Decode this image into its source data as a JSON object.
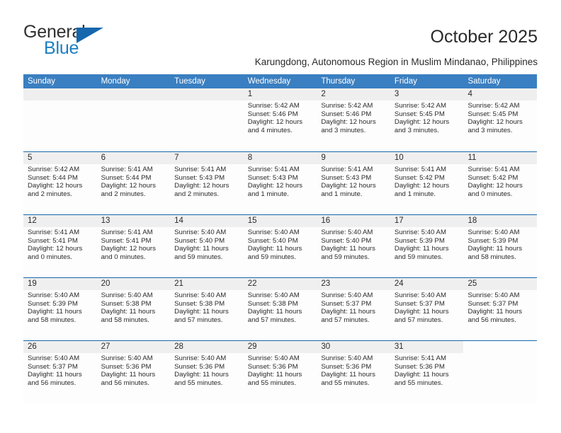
{
  "brand": {
    "name_part1": "General",
    "name_part2": "Blue",
    "accent_color": "#1667ad"
  },
  "header": {
    "month_title": "October 2025",
    "location": "Karungdong, Autonomous Region in Muslim Mindanao, Philippines"
  },
  "calendar": {
    "header_bg": "#3a7fc1",
    "weekdays": [
      "Sunday",
      "Monday",
      "Tuesday",
      "Wednesday",
      "Thursday",
      "Friday",
      "Saturday"
    ],
    "weeks": [
      [
        {
          "day": "",
          "sunrise": "",
          "sunset": "",
          "daylight": "",
          "daylight2": ""
        },
        {
          "day": "",
          "sunrise": "",
          "sunset": "",
          "daylight": "",
          "daylight2": ""
        },
        {
          "day": "",
          "sunrise": "",
          "sunset": "",
          "daylight": "",
          "daylight2": ""
        },
        {
          "day": "1",
          "sunrise": "Sunrise: 5:42 AM",
          "sunset": "Sunset: 5:46 PM",
          "daylight": "Daylight: 12 hours",
          "daylight2": "and 4 minutes."
        },
        {
          "day": "2",
          "sunrise": "Sunrise: 5:42 AM",
          "sunset": "Sunset: 5:46 PM",
          "daylight": "Daylight: 12 hours",
          "daylight2": "and 3 minutes."
        },
        {
          "day": "3",
          "sunrise": "Sunrise: 5:42 AM",
          "sunset": "Sunset: 5:45 PM",
          "daylight": "Daylight: 12 hours",
          "daylight2": "and 3 minutes."
        },
        {
          "day": "4",
          "sunrise": "Sunrise: 5:42 AM",
          "sunset": "Sunset: 5:45 PM",
          "daylight": "Daylight: 12 hours",
          "daylight2": "and 3 minutes."
        }
      ],
      [
        {
          "day": "5",
          "sunrise": "Sunrise: 5:42 AM",
          "sunset": "Sunset: 5:44 PM",
          "daylight": "Daylight: 12 hours",
          "daylight2": "and 2 minutes."
        },
        {
          "day": "6",
          "sunrise": "Sunrise: 5:41 AM",
          "sunset": "Sunset: 5:44 PM",
          "daylight": "Daylight: 12 hours",
          "daylight2": "and 2 minutes."
        },
        {
          "day": "7",
          "sunrise": "Sunrise: 5:41 AM",
          "sunset": "Sunset: 5:43 PM",
          "daylight": "Daylight: 12 hours",
          "daylight2": "and 2 minutes."
        },
        {
          "day": "8",
          "sunrise": "Sunrise: 5:41 AM",
          "sunset": "Sunset: 5:43 PM",
          "daylight": "Daylight: 12 hours",
          "daylight2": "and 1 minute."
        },
        {
          "day": "9",
          "sunrise": "Sunrise: 5:41 AM",
          "sunset": "Sunset: 5:43 PM",
          "daylight": "Daylight: 12 hours",
          "daylight2": "and 1 minute."
        },
        {
          "day": "10",
          "sunrise": "Sunrise: 5:41 AM",
          "sunset": "Sunset: 5:42 PM",
          "daylight": "Daylight: 12 hours",
          "daylight2": "and 1 minute."
        },
        {
          "day": "11",
          "sunrise": "Sunrise: 5:41 AM",
          "sunset": "Sunset: 5:42 PM",
          "daylight": "Daylight: 12 hours",
          "daylight2": "and 0 minutes."
        }
      ],
      [
        {
          "day": "12",
          "sunrise": "Sunrise: 5:41 AM",
          "sunset": "Sunset: 5:41 PM",
          "daylight": "Daylight: 12 hours",
          "daylight2": "and 0 minutes."
        },
        {
          "day": "13",
          "sunrise": "Sunrise: 5:41 AM",
          "sunset": "Sunset: 5:41 PM",
          "daylight": "Daylight: 12 hours",
          "daylight2": "and 0 minutes."
        },
        {
          "day": "14",
          "sunrise": "Sunrise: 5:40 AM",
          "sunset": "Sunset: 5:40 PM",
          "daylight": "Daylight: 11 hours",
          "daylight2": "and 59 minutes."
        },
        {
          "day": "15",
          "sunrise": "Sunrise: 5:40 AM",
          "sunset": "Sunset: 5:40 PM",
          "daylight": "Daylight: 11 hours",
          "daylight2": "and 59 minutes."
        },
        {
          "day": "16",
          "sunrise": "Sunrise: 5:40 AM",
          "sunset": "Sunset: 5:40 PM",
          "daylight": "Daylight: 11 hours",
          "daylight2": "and 59 minutes."
        },
        {
          "day": "17",
          "sunrise": "Sunrise: 5:40 AM",
          "sunset": "Sunset: 5:39 PM",
          "daylight": "Daylight: 11 hours",
          "daylight2": "and 59 minutes."
        },
        {
          "day": "18",
          "sunrise": "Sunrise: 5:40 AM",
          "sunset": "Sunset: 5:39 PM",
          "daylight": "Daylight: 11 hours",
          "daylight2": "and 58 minutes."
        }
      ],
      [
        {
          "day": "19",
          "sunrise": "Sunrise: 5:40 AM",
          "sunset": "Sunset: 5:39 PM",
          "daylight": "Daylight: 11 hours",
          "daylight2": "and 58 minutes."
        },
        {
          "day": "20",
          "sunrise": "Sunrise: 5:40 AM",
          "sunset": "Sunset: 5:38 PM",
          "daylight": "Daylight: 11 hours",
          "daylight2": "and 58 minutes."
        },
        {
          "day": "21",
          "sunrise": "Sunrise: 5:40 AM",
          "sunset": "Sunset: 5:38 PM",
          "daylight": "Daylight: 11 hours",
          "daylight2": "and 57 minutes."
        },
        {
          "day": "22",
          "sunrise": "Sunrise: 5:40 AM",
          "sunset": "Sunset: 5:38 PM",
          "daylight": "Daylight: 11 hours",
          "daylight2": "and 57 minutes."
        },
        {
          "day": "23",
          "sunrise": "Sunrise: 5:40 AM",
          "sunset": "Sunset: 5:37 PM",
          "daylight": "Daylight: 11 hours",
          "daylight2": "and 57 minutes."
        },
        {
          "day": "24",
          "sunrise": "Sunrise: 5:40 AM",
          "sunset": "Sunset: 5:37 PM",
          "daylight": "Daylight: 11 hours",
          "daylight2": "and 57 minutes."
        },
        {
          "day": "25",
          "sunrise": "Sunrise: 5:40 AM",
          "sunset": "Sunset: 5:37 PM",
          "daylight": "Daylight: 11 hours",
          "daylight2": "and 56 minutes."
        }
      ],
      [
        {
          "day": "26",
          "sunrise": "Sunrise: 5:40 AM",
          "sunset": "Sunset: 5:37 PM",
          "daylight": "Daylight: 11 hours",
          "daylight2": "and 56 minutes."
        },
        {
          "day": "27",
          "sunrise": "Sunrise: 5:40 AM",
          "sunset": "Sunset: 5:36 PM",
          "daylight": "Daylight: 11 hours",
          "daylight2": "and 56 minutes."
        },
        {
          "day": "28",
          "sunrise": "Sunrise: 5:40 AM",
          "sunset": "Sunset: 5:36 PM",
          "daylight": "Daylight: 11 hours",
          "daylight2": "and 55 minutes."
        },
        {
          "day": "29",
          "sunrise": "Sunrise: 5:40 AM",
          "sunset": "Sunset: 5:36 PM",
          "daylight": "Daylight: 11 hours",
          "daylight2": "and 55 minutes."
        },
        {
          "day": "30",
          "sunrise": "Sunrise: 5:40 AM",
          "sunset": "Sunset: 5:36 PM",
          "daylight": "Daylight: 11 hours",
          "daylight2": "and 55 minutes."
        },
        {
          "day": "31",
          "sunrise": "Sunrise: 5:41 AM",
          "sunset": "Sunset: 5:36 PM",
          "daylight": "Daylight: 11 hours",
          "daylight2": "and 55 minutes."
        },
        {
          "day": "",
          "sunrise": "",
          "sunset": "",
          "daylight": "",
          "daylight2": ""
        }
      ]
    ]
  }
}
